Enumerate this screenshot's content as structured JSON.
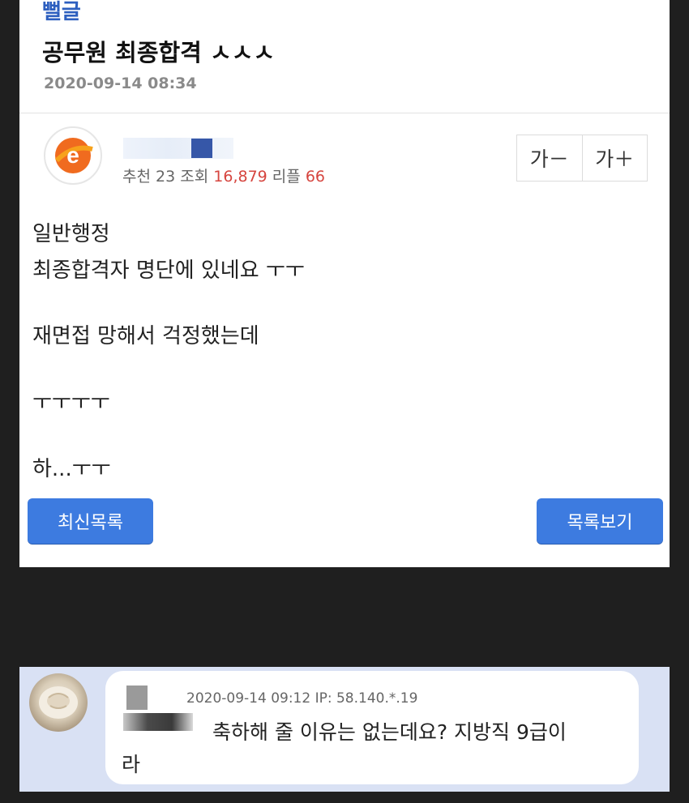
{
  "post": {
    "category": "뻘글",
    "title": "공무원 최종합격 ㅅㅅㅅ",
    "date": "2020-09-14 08:34",
    "stats": {
      "recommend_label": "추천",
      "recommend_value": "23",
      "views_label": "조회",
      "views_value": "16,879",
      "replies_label": "리플",
      "replies_value": "66"
    },
    "font_controls": {
      "decrease": "가－",
      "increase": "가＋"
    },
    "body_lines": [
      "일반행정",
      "최종합격자 명단에 있네요 ㅜㅜ",
      "재면접 망해서 걱정했는데",
      "ㅜㅜㅜㅜ",
      "하...ㅜㅜ"
    ],
    "buttons": {
      "latest": "최신목록",
      "list": "목록보기"
    }
  },
  "comment": {
    "meta": "2020-09-14 09:12   IP: 58.140.*.19",
    "text_line1": "축하해 줄 이유는 없는데요? 지방직 9급이",
    "text_line2": "라"
  },
  "colors": {
    "category": "#2d5fbf",
    "accent_button": "#3d7be0",
    "stat_highlight": "#d6453f",
    "comment_panel": "#d9e1f4",
    "page_background": "#1f1f1f"
  }
}
